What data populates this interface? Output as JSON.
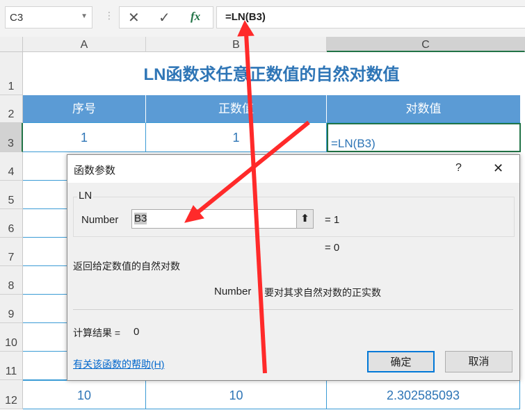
{
  "formula_bar": {
    "name_box": "C3",
    "formula": "=LN(B3)",
    "cancel_icon": "✕",
    "enter_icon": "✓",
    "fx_label": "fx"
  },
  "columns": [
    "A",
    "B",
    "C"
  ],
  "rows": [
    "1",
    "2",
    "3",
    "4",
    "5",
    "6",
    "7",
    "8",
    "9",
    "10",
    "11",
    "12"
  ],
  "sheet": {
    "title": "LN函数求任意正数值的自然对数值",
    "headers": [
      "序号",
      "正数值",
      "对数值"
    ],
    "row3": [
      "1",
      "1",
      "=LN(B3)"
    ],
    "row12": [
      "10",
      "10",
      "2.302585093"
    ]
  },
  "dialog": {
    "title": "函数参数",
    "help": "?",
    "close": "✕",
    "group": "LN",
    "arg_label": "Number",
    "arg_value": "B3",
    "arg_result": "=  1",
    "func_result": "=  0",
    "description": "返回给定数值的自然对数",
    "arg_desc_name": "Number",
    "arg_desc": "要对其求自然对数的正实数",
    "calc_label": "计算结果 =",
    "calc_value": "0",
    "help_link": "有关该函数的帮助(H)",
    "ok": "确定",
    "cancel": "取消"
  },
  "colors": {
    "accent": "#5b9bd5",
    "arrow": "#ff2a2a"
  }
}
